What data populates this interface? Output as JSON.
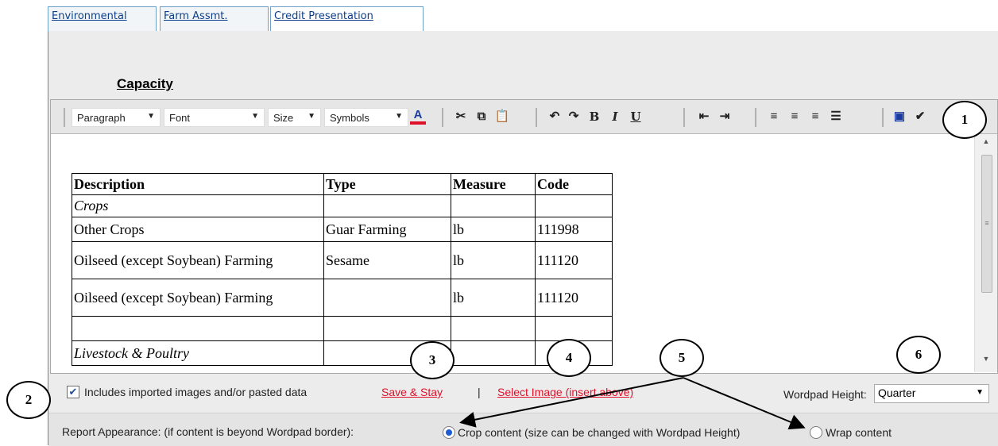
{
  "tabs": [
    {
      "label": "Environmental"
    },
    {
      "label": "Farm Assmt."
    },
    {
      "label": "Credit Presentation"
    }
  ],
  "section": {
    "title": "Capacity"
  },
  "toolbar": {
    "paragraph": "Paragraph",
    "font": "Font",
    "size": "Size",
    "symbols": "Symbols"
  },
  "table": {
    "headers": [
      "Description",
      "Type",
      "Measure",
      "Code"
    ],
    "rows": [
      {
        "description": "Crops",
        "type": "",
        "measure": "",
        "code": ""
      },
      {
        "description": "Other Crops",
        "type": "Guar Farming",
        "measure": "lb",
        "code": "111998"
      },
      {
        "description": "Oilseed (except Soybean) Farming",
        "type": "Sesame",
        "measure": "lb",
        "code": "111120"
      },
      {
        "description": "Oilseed (except Soybean) Farming",
        "type": "",
        "measure": "lb",
        "code": "111120"
      },
      {
        "description": "",
        "type": "",
        "measure": "",
        "code": ""
      },
      {
        "description": "Livestock & Poultry",
        "type": "",
        "measure": "",
        "code": ""
      }
    ]
  },
  "options": {
    "imported_label": "Includes imported images and/or pasted data",
    "imported_checked": true,
    "save_stay": "Save & Stay",
    "divider": "|",
    "select_image": "Select Image (insert above)",
    "wordpad_height_label": "Wordpad Height:",
    "wordpad_height_value": "Quarter"
  },
  "report": {
    "label": "Report Appearance: (if content is beyond Wordpad border):",
    "crop_label": "Crop content (size can be changed with Wordpad Height)",
    "wrap_label": "Wrap content",
    "selected": "crop"
  },
  "annotations": [
    "1",
    "2",
    "3",
    "4",
    "5",
    "6"
  ]
}
